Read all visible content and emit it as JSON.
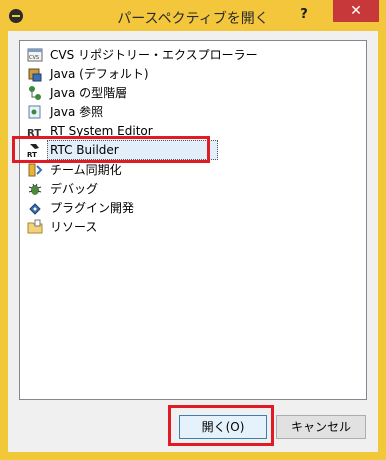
{
  "window": {
    "title": "パースペクティブを開く",
    "help_label": "?",
    "close_label": "✕"
  },
  "perspectives": [
    {
      "label": "CVS リポジトリー・エクスプローラー",
      "icon": "cvs-icon"
    },
    {
      "label": "Java (デフォルト)",
      "icon": "java-icon"
    },
    {
      "label": "Java の型階層",
      "icon": "type-hierarchy-icon"
    },
    {
      "label": "Java 参照",
      "icon": "java-browse-icon"
    },
    {
      "label": "RT System Editor",
      "icon": "rt-system-editor-icon"
    },
    {
      "label": "RTC Builder",
      "icon": "rtc-builder-icon",
      "selected": true
    },
    {
      "label": "チーム同期化",
      "icon": "team-sync-icon"
    },
    {
      "label": "デバッグ",
      "icon": "debug-icon"
    },
    {
      "label": "プラグイン開発",
      "icon": "plugin-dev-icon"
    },
    {
      "label": "リソース",
      "icon": "resource-icon"
    }
  ],
  "buttons": {
    "open": "開く(O)",
    "cancel": "キャンセル"
  },
  "colors": {
    "title_bar": "#f3c63c",
    "highlight": "#e01b24",
    "close": "#c7383a"
  }
}
